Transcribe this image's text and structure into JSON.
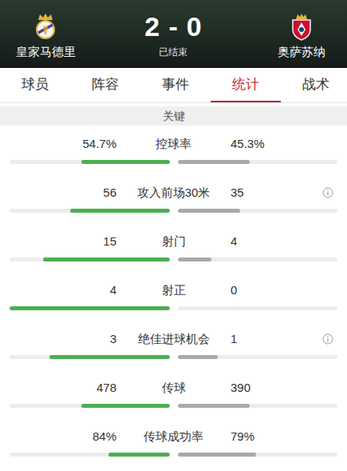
{
  "header": {
    "home": {
      "name": "皇家马德里"
    },
    "away": {
      "name": "奥萨苏纳"
    },
    "score": "2 - 0",
    "status": "已结束"
  },
  "tabs": [
    {
      "label": "球员",
      "selected": false
    },
    {
      "label": "阵容",
      "selected": false
    },
    {
      "label": "事件",
      "selected": false
    },
    {
      "label": "统计",
      "selected": true
    },
    {
      "label": "战术",
      "selected": false
    }
  ],
  "section": "关键",
  "stats": [
    {
      "label": "控球率",
      "home": "54.7%",
      "away": "45.3%",
      "home_level": 0.55,
      "away_level": 0.45,
      "info": false
    },
    {
      "label": "攻入前场30米",
      "home": "56",
      "away": "35",
      "home_level": 0.62,
      "away_level": 0.39,
      "info": true
    },
    {
      "label": "射门",
      "home": "15",
      "away": "4",
      "home_level": 0.79,
      "away_level": 0.21,
      "info": false
    },
    {
      "label": "射正",
      "home": "4",
      "away": "0",
      "home_level": 1,
      "away_level": 0,
      "info": false
    },
    {
      "label": "绝佳进球机会",
      "home": "3",
      "away": "1",
      "home_level": 0.75,
      "away_level": 0.25,
      "info": true
    },
    {
      "label": "传球",
      "home": "478",
      "away": "390",
      "home_level": 0.55,
      "away_level": 0.45,
      "info": false
    },
    {
      "label": "传球成功率",
      "home": "84%",
      "away": "79%",
      "home_level": 0.38,
      "away_level": 0.49,
      "info": false
    }
  ]
}
